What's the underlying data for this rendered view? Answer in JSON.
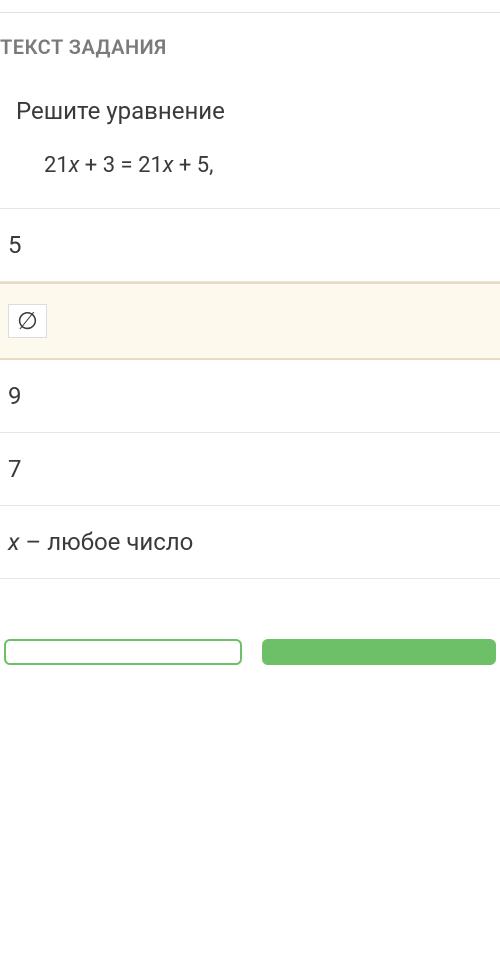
{
  "header": {
    "section_label": "ТЕКСТ ЗАДАНИЯ"
  },
  "question": {
    "title": "Решите уравнение",
    "equation_prefix": "21",
    "equation_var1": "x",
    "equation_mid1": " + 3 = 21",
    "equation_var2": "x",
    "equation_mid2": " + 5,"
  },
  "answers": {
    "option1": "5",
    "option2": "∅",
    "option3": "9",
    "option4": "7",
    "option5_var": "x",
    "option5_text": " – любое число"
  },
  "selected_index": 1
}
